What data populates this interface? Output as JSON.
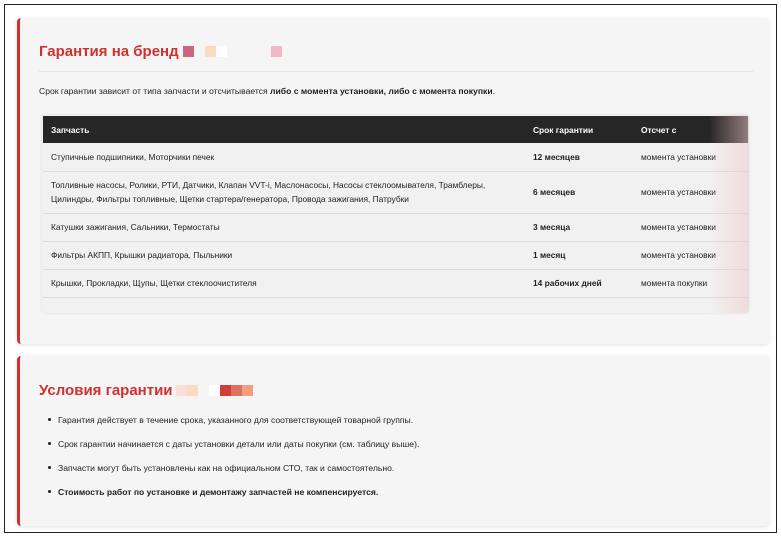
{
  "warranty": {
    "title": "Гарантия на бренд",
    "title_censor": [
      "#c8677f",
      "#f5f5f5",
      "#f8dcc0",
      "#ffffff",
      "#f5f5f5",
      "#f5f5f5",
      "#f5f5f5",
      "#f5f5f5",
      "#f2b8c8"
    ],
    "intro_prefix": "Срок гарантии зависит от типа запчасти и отсчитывается ",
    "intro_bold": "либо с момента установки, либо с момента покупки",
    "intro_suffix": ".",
    "table": {
      "headers": [
        "Запчасть",
        "Срок гарантии",
        "Отсчет с"
      ],
      "rows": [
        {
          "part": "Ступичные подшипники, Моторчики печек",
          "period": "12 месяцев",
          "from": "момента установки"
        },
        {
          "part": "Топливные насосы, Ролики, РТИ, Датчики, Клапан VVT-i, Маслонасосы, Насосы стеклоомывателя, Трамблеры, Цилиндры, Фильтры топливные, Щетки стартера/генератора, Провода зажигания, Патрубки",
          "period": "6 месяцев",
          "from": "момента установки"
        },
        {
          "part": "Катушки зажигания, Сальники, Термостаты",
          "period": "3 месяца",
          "from": "момента установки"
        },
        {
          "part": "Фильтры АКПП, Крышки радиатора, Пыльники",
          "period": "1 месяц",
          "from": "момента установки"
        },
        {
          "part": "Крышки, Прокладки, Щупы, Щетки стеклоочистителя",
          "period": "14 рабочих дней",
          "from": "момента покупки"
        }
      ]
    }
  },
  "conditions": {
    "title": "Условия гарантии",
    "title_censor": [
      "#f8e0d8",
      "#f8dcc0",
      "#f5f5f5",
      "#ffffff",
      "#d0403a",
      "#e07060",
      "#f0a080",
      "#f5f5f5",
      "#f5f5f5"
    ],
    "items": [
      {
        "text": "Гарантия действует в течение срока, указанного для соответствующей товарной группы.",
        "strong": false
      },
      {
        "text": "Срок гарантии начинается с даты установки детали или даты покупки (см. таблицу выше).",
        "strong": false
      },
      {
        "text": "Запчасти могут быть установлены как на официальном СТО, так и самостоятельно.",
        "strong": false
      },
      {
        "text": "Стоимость работ по установке и демонтажу запчастей не компенсируется.",
        "strong": true
      }
    ]
  }
}
